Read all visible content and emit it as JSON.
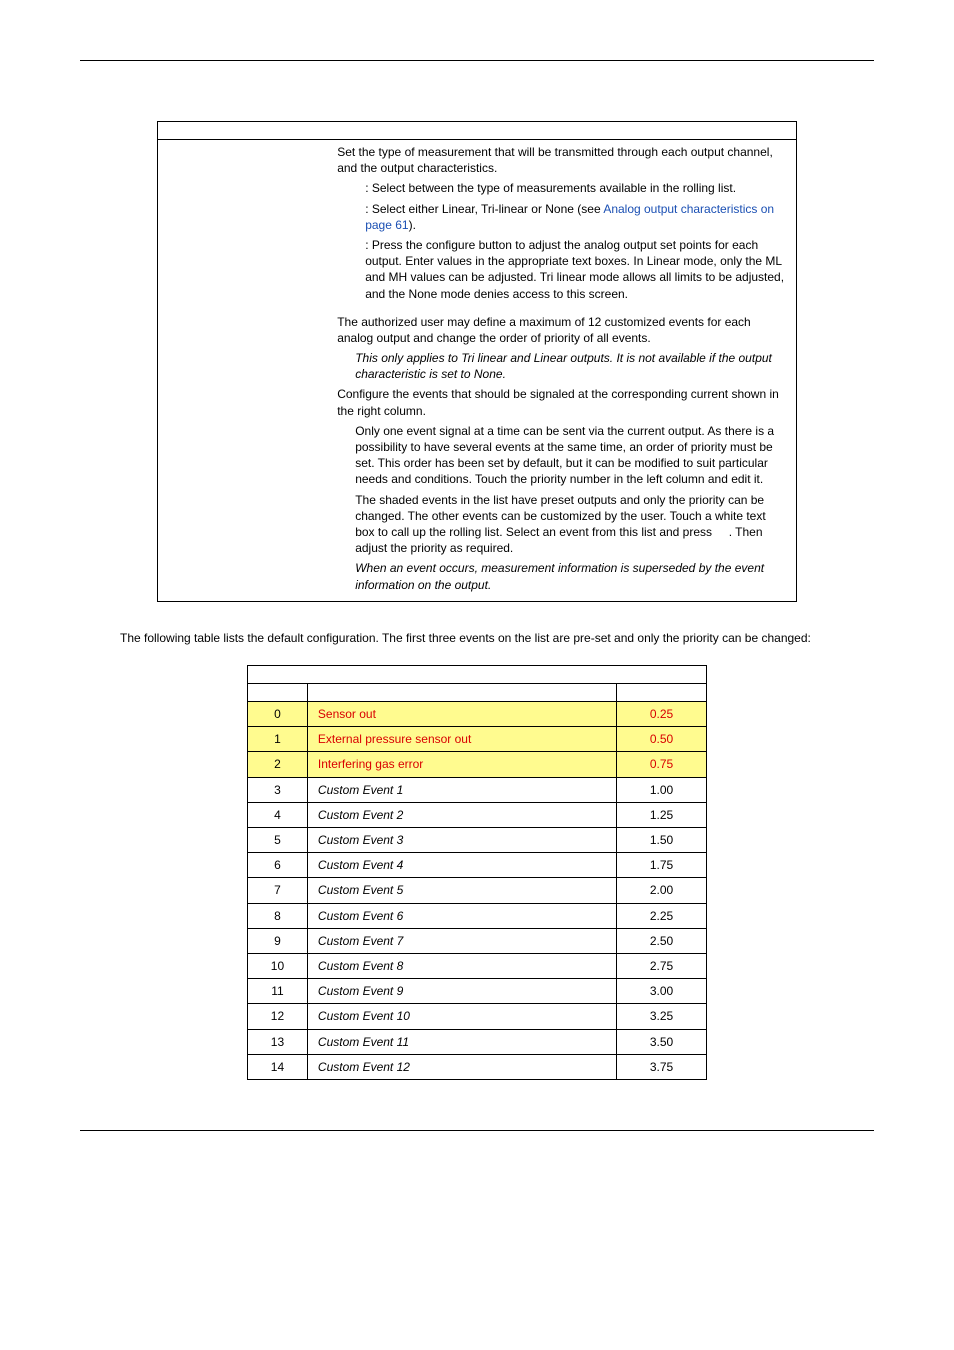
{
  "configTable": {
    "rows": [
      {
        "left": "",
        "right": [
          {
            "cls": "sub-block",
            "html": "Set the type of measurement that will be transmitted through each output channel, and the output characteristics."
          },
          {
            "cls": "sub-block indent1",
            "html": ": Select between the type of measurements available in the rolling list."
          },
          {
            "cls": "sub-block indent1",
            "html": ": Select either Linear, Tri-linear or None (see <span class='link'>Analog output characteristics on page 61</span>)."
          },
          {
            "cls": "sub-block indent1",
            "html": ": Press the configure button to adjust the analog output set points for each output. Enter values in the appropriate text boxes. In Linear mode, only the ML and MH values can be adjusted. Tri linear mode allows all limits to be adjusted, and the None mode denies access to this screen."
          }
        ]
      },
      {
        "left": "",
        "right": [
          {
            "cls": "sub-block",
            "html": "The authorized user may define a maximum of 12 customized events for each analog output and change the order of priority of all events."
          },
          {
            "cls": "sub-block indent1b italic",
            "html": "This only applies to Tri linear and Linear outputs. It is not available if the output characteristic is set to None."
          },
          {
            "cls": "sub-block",
            "html": "Configure the events that should be signaled at the corresponding current shown in the right column."
          },
          {
            "cls": "sub-block indent1b",
            "html": "Only one event signal at a time can be sent via the current output. As there is a possibility to have several events at the same time, an order of priority must be set. This order has been set by default, but it can be modified to suit particular needs and conditions. Touch the priority number in the left column and edit it."
          },
          {
            "cls": "sub-block indent1b",
            "html": "The shaded events in the list have preset outputs and only the priority can be changed. The other events can be customized by the user. Touch a white text box to call up the rolling list. Select an event from this list and press &nbsp;&nbsp;&nbsp;&nbsp;. Then adjust the priority as required."
          },
          {
            "cls": "sub-block indent1b italic",
            "html": "When an event occurs, measurement information is superseded by the event information on the output."
          }
        ]
      }
    ]
  },
  "introText": "The following table lists the default configuration. The first three events on the list are pre-set and only the priority can be changed:",
  "eventsTable": {
    "rows": [
      {
        "priority": "0",
        "event": "Sensor out",
        "output": "0.25",
        "shaded": true
      },
      {
        "priority": "1",
        "event": "External pressure sensor out",
        "output": "0.50",
        "shaded": true
      },
      {
        "priority": "2",
        "event": "Interfering gas error",
        "output": "0.75",
        "shaded": true
      },
      {
        "priority": "3",
        "event": "Custom Event 1",
        "output": "1.00",
        "shaded": false
      },
      {
        "priority": "4",
        "event": "Custom Event 2",
        "output": "1.25",
        "shaded": false
      },
      {
        "priority": "5",
        "event": "Custom Event 3",
        "output": "1.50",
        "shaded": false
      },
      {
        "priority": "6",
        "event": "Custom Event 4",
        "output": "1.75",
        "shaded": false
      },
      {
        "priority": "7",
        "event": "Custom Event 5",
        "output": "2.00",
        "shaded": false
      },
      {
        "priority": "8",
        "event": "Custom Event 6",
        "output": "2.25",
        "shaded": false
      },
      {
        "priority": "9",
        "event": "Custom Event 7",
        "output": "2.50",
        "shaded": false
      },
      {
        "priority": "10",
        "event": "Custom Event 8",
        "output": "2.75",
        "shaded": false
      },
      {
        "priority": "11",
        "event": "Custom Event 9",
        "output": "3.00",
        "shaded": false
      },
      {
        "priority": "12",
        "event": "Custom Event 10",
        "output": "3.25",
        "shaded": false
      },
      {
        "priority": "13",
        "event": "Custom Event 11",
        "output": "3.50",
        "shaded": false
      },
      {
        "priority": "14",
        "event": "Custom Event 12",
        "output": "3.75",
        "shaded": false
      }
    ]
  }
}
